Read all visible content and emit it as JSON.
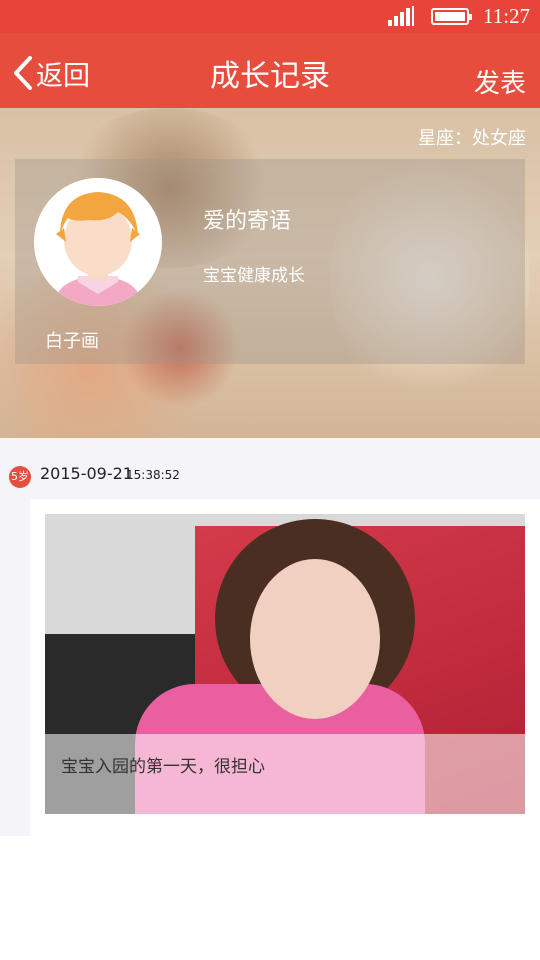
{
  "status_bar": {
    "time": "11:27"
  },
  "nav": {
    "back_label": "返回",
    "title": "成长记录",
    "publish_label": "发表"
  },
  "profile": {
    "constellation": "星座：处女座",
    "baby_name": "白子画",
    "motto_title": "爱的寄语",
    "motto_text": "宝宝健康成长"
  },
  "timeline": [
    {
      "age_badge": "5岁",
      "date": "2015-09-21",
      "time": "15:38:52",
      "caption": "宝宝入园的第一天，很担心"
    }
  ],
  "colors": {
    "accent": "#e64d3d",
    "status_bar": "#e8443a",
    "timeline_bg": "#f4f4f9"
  }
}
